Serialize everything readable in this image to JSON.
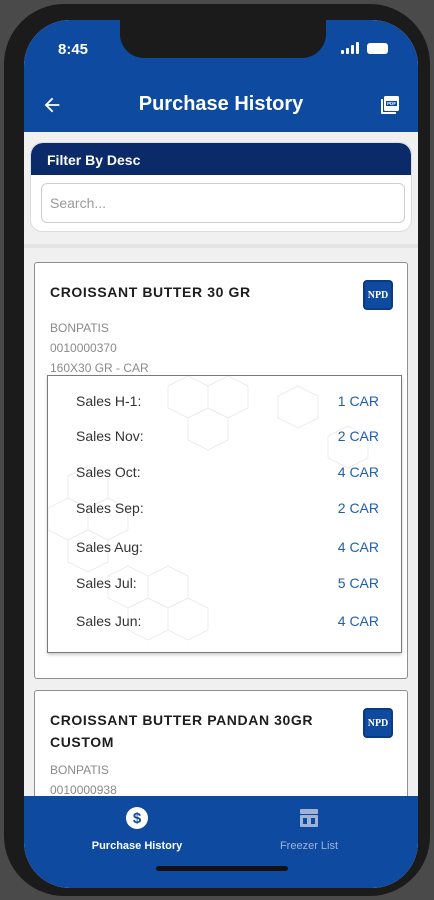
{
  "status_bar": {
    "time": "8:45"
  },
  "header": {
    "title": "Purchase History",
    "back_icon": "arrow-left-icon",
    "action_icon": "pdf-icon"
  },
  "filter": {
    "title": "Filter By Desc",
    "search_placeholder": "Search...",
    "search_value": ""
  },
  "products": [
    {
      "name": "CROISSANT BUTTER 30 GR",
      "badge": "NPD",
      "brand": "BONPATIS",
      "code": "0010000370",
      "pack": "160X30 GR - CAR",
      "sales": [
        {
          "label": "Sales H-1:",
          "value": "1 CAR"
        },
        {
          "label": "Sales Nov:",
          "value": "2 CAR"
        },
        {
          "label": "Sales Oct:",
          "value": "4 CAR"
        },
        {
          "label": "Sales Sep:",
          "value": "2 CAR"
        },
        {
          "label": "Sales Aug:",
          "value": "4 CAR"
        },
        {
          "label": "Sales Jul:",
          "value": "5 CAR"
        },
        {
          "label": "Sales Jun:",
          "value": "4 CAR"
        }
      ]
    },
    {
      "name": "CROISSANT BUTTER PANDAN 30GR CUSTOM",
      "badge": "NPD",
      "brand": "BONPATIS",
      "code": "0010000938"
    }
  ],
  "bottom_nav": [
    {
      "label": "Purchase History",
      "icon": "dollar-circle-icon",
      "active": true
    },
    {
      "label": "Freezer List",
      "icon": "freezer-icon",
      "active": false
    }
  ],
  "colors": {
    "primary": "#0d4aa0",
    "filter_header": "#0a2a6a",
    "value_text": "#1f5fb0"
  }
}
